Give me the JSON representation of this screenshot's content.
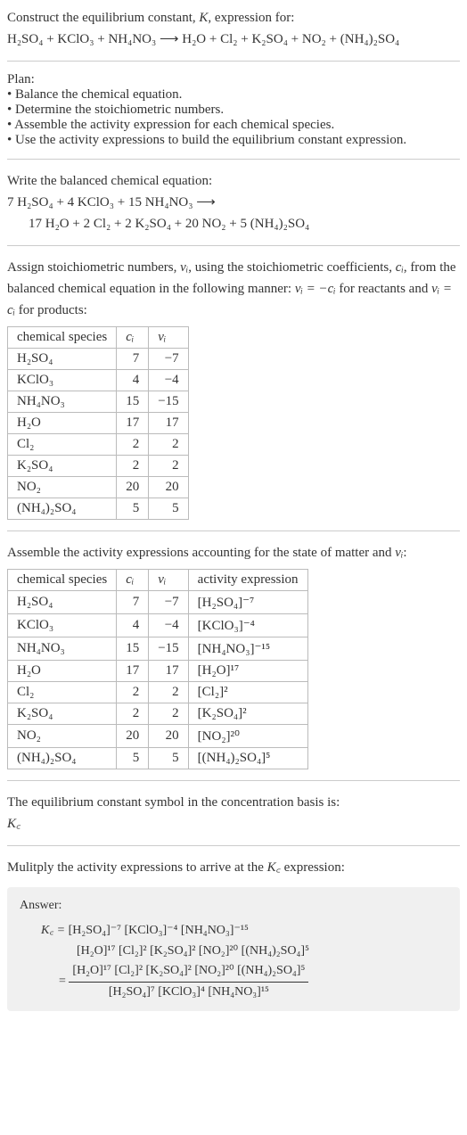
{
  "intro": {
    "line1_prefix": "Construct the equilibrium constant, ",
    "K": "K",
    "line1_suffix": ", expression for:",
    "reaction": "H₂SO₄ + KClO₃ + NH₄NO₃ ⟶ H₂O + Cl₂ + K₂SO₄ + NO₂ + (NH₄)₂SO₄"
  },
  "plan": {
    "heading": "Plan:",
    "items": [
      "• Balance the chemical equation.",
      "• Determine the stoichiometric numbers.",
      "• Assemble the activity expression for each chemical species.",
      "• Use the activity expressions to build the equilibrium constant expression."
    ]
  },
  "balanced": {
    "heading": "Write the balanced chemical equation:",
    "line1": "7 H₂SO₄ + 4 KClO₃ + 15 NH₄NO₃ ⟶",
    "line2": "17 H₂O + 2 Cl₂ + 2 K₂SO₄ + 20 NO₂ + 5 (NH₄)₂SO₄"
  },
  "stoich": {
    "intro_a": "Assign stoichiometric numbers, ",
    "nu": "νᵢ",
    "intro_b": ", using the stoichiometric coefficients, ",
    "ci": "cᵢ",
    "intro_c": ", from the balanced chemical equation in the following manner: ",
    "rel_react": "νᵢ = −cᵢ",
    "intro_d": " for reactants and ",
    "rel_prod": "νᵢ = cᵢ",
    "intro_e": " for products:",
    "headers": {
      "species": "chemical species",
      "ci": "cᵢ",
      "nu": "νᵢ"
    },
    "rows": [
      {
        "species": "H₂SO₄",
        "ci": "7",
        "nu": "−7"
      },
      {
        "species": "KClO₃",
        "ci": "4",
        "nu": "−4"
      },
      {
        "species": "NH₄NO₃",
        "ci": "15",
        "nu": "−15"
      },
      {
        "species": "H₂O",
        "ci": "17",
        "nu": "17"
      },
      {
        "species": "Cl₂",
        "ci": "2",
        "nu": "2"
      },
      {
        "species": "K₂SO₄",
        "ci": "2",
        "nu": "2"
      },
      {
        "species": "NO₂",
        "ci": "20",
        "nu": "20"
      },
      {
        "species": "(NH₄)₂SO₄",
        "ci": "5",
        "nu": "5"
      }
    ]
  },
  "activity": {
    "heading_a": "Assemble the activity expressions accounting for the state of matter and ",
    "heading_b": "νᵢ",
    "heading_c": ":",
    "headers": {
      "species": "chemical species",
      "ci": "cᵢ",
      "nu": "νᵢ",
      "expr": "activity expression"
    },
    "rows": [
      {
        "species": "H₂SO₄",
        "ci": "7",
        "nu": "−7",
        "expr": "[H₂SO₄]⁻⁷"
      },
      {
        "species": "KClO₃",
        "ci": "4",
        "nu": "−4",
        "expr": "[KClO₃]⁻⁴"
      },
      {
        "species": "NH₄NO₃",
        "ci": "15",
        "nu": "−15",
        "expr": "[NH₄NO₃]⁻¹⁵"
      },
      {
        "species": "H₂O",
        "ci": "17",
        "nu": "17",
        "expr": "[H₂O]¹⁷"
      },
      {
        "species": "Cl₂",
        "ci": "2",
        "nu": "2",
        "expr": "[Cl₂]²"
      },
      {
        "species": "K₂SO₄",
        "ci": "2",
        "nu": "2",
        "expr": "[K₂SO₄]²"
      },
      {
        "species": "NO₂",
        "ci": "20",
        "nu": "20",
        "expr": "[NO₂]²⁰"
      },
      {
        "species": "(NH₄)₂SO₄",
        "ci": "5",
        "nu": "5",
        "expr": "[(NH₄)₂SO₄]⁵"
      }
    ]
  },
  "kc_symbol": {
    "line": "The equilibrium constant symbol in the concentration basis is:",
    "symbol": "K꜀"
  },
  "multiply": {
    "line_a": "Mulitply the activity expressions to arrive at the ",
    "kc": "K꜀",
    "line_b": " expression:"
  },
  "answer": {
    "label": "Answer:",
    "kc_eq": "K꜀ = ",
    "prod_line1": "[H₂SO₄]⁻⁷ [KClO₃]⁻⁴ [NH₄NO₃]⁻¹⁵",
    "prod_line2": "[H₂O]¹⁷ [Cl₂]² [K₂SO₄]² [NO₂]²⁰ [(NH₄)₂SO₄]⁵",
    "equals": "= ",
    "frac_num": "[H₂O]¹⁷ [Cl₂]² [K₂SO₄]² [NO₂]²⁰ [(NH₄)₂SO₄]⁵",
    "frac_den": "[H₂SO₄]⁷ [KClO₃]⁴ [NH₄NO₃]¹⁵"
  }
}
